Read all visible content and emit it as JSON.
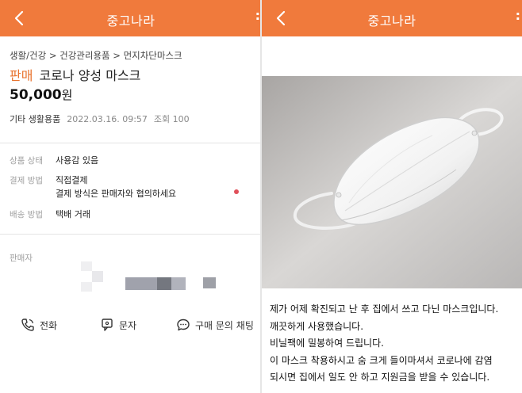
{
  "left": {
    "app_title": "중고나라",
    "breadcrumb": "생활/건강 > 건강관리용품 > 먼지차단마스크",
    "status_tag": "판매",
    "product_title": "코로나 양성 마스크",
    "price_number": "50,000",
    "price_unit": "원",
    "category": "기타 생활용품",
    "posted_date": "2022.03.16. 09:57",
    "views": "조회 100",
    "info": {
      "condition_label": "상품 상태",
      "condition_value": "사용감 있음",
      "payment_label": "결제 방법",
      "payment_value": "직접결제",
      "payment_note": "결제 방식은 판매자와 협의하세요",
      "shipping_label": "배송 방법",
      "shipping_value": "택배 거래"
    },
    "seller_label": "판매자",
    "contact": {
      "call": "전화",
      "sms": "문자",
      "chat": "구매 문의 채팅"
    }
  },
  "right": {
    "app_title": "중고나라",
    "description": [
      "제가 어제 확진되고 난 후 집에서 쓰고 다닌 마스크입니다.",
      "깨끗하게 사용했습니다.",
      "비닐팩에 밀봉하여 드립니다.",
      "이 마스크 착용하시고 숨 크게 들이마셔서 코로나에 감염",
      "되시면 집에서 일도 안 하고 지원금을 받을 수 있습니다."
    ]
  },
  "colors": {
    "brand_orange": "#f07a3c",
    "status_orange": "#e8732e",
    "dot_red": "#e0505a",
    "label_gray": "#a0a0a0"
  },
  "icons": [
    "back-icon",
    "more-icon",
    "phone-icon",
    "message-icon",
    "chat-icon"
  ]
}
